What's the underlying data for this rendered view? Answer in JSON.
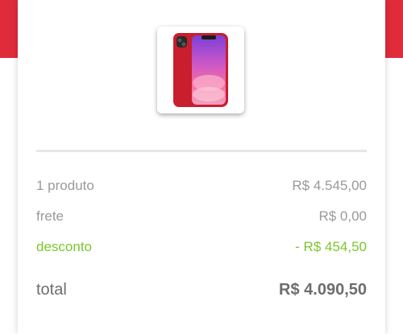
{
  "summary": {
    "products_label": "1 produto",
    "products_value": "R$ 4.545,00",
    "shipping_label": "frete",
    "shipping_value": "R$ 0,00",
    "discount_label": "desconto",
    "discount_value": "- R$ 454,50",
    "total_label": "total",
    "total_value": "R$ 4.090,50"
  },
  "colors": {
    "brand_red": "#e02b3b",
    "discount_green": "#7dc62b",
    "muted_text": "#9a9a9a",
    "total_text": "#6d6d6d"
  },
  "icons": {
    "product_image": "red-smartphone-image"
  }
}
